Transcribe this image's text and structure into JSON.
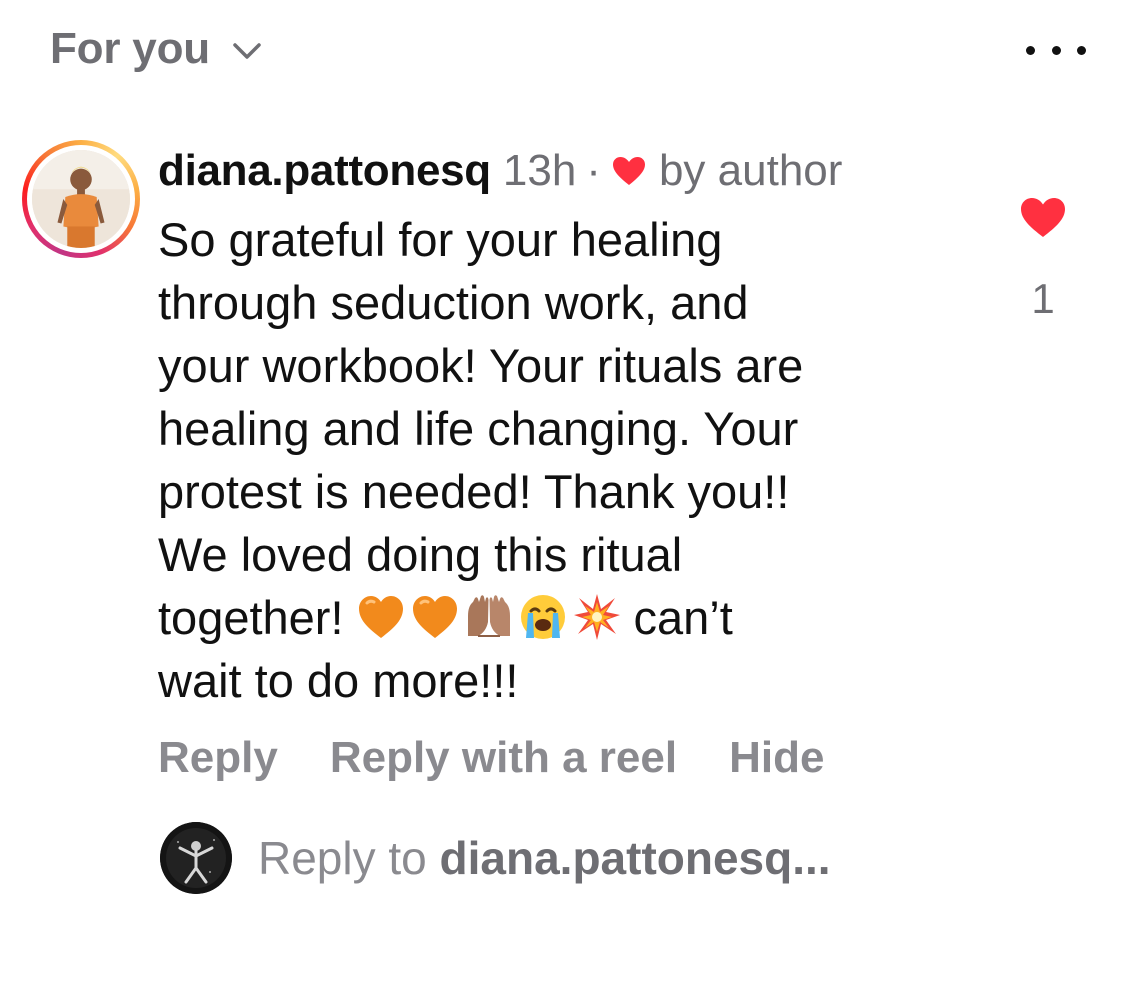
{
  "header": {
    "feed_label": "For you",
    "chevron_icon": "chevron-down-icon",
    "more_icon": "more-horizontal-icon"
  },
  "comment": {
    "username": "diana.pattonesq",
    "time": "13h",
    "separator": "·",
    "liked_by_author_icon": "heart-icon",
    "by_author": "by author",
    "text_lines": [
      "So grateful for your healing",
      "through seduction work, and",
      "your workbook! Your rituals are",
      "healing and life changing. Your",
      "protest is needed! Thank you!!",
      "We loved doing this ritual",
      "together!"
    ],
    "emojis": [
      "orange-heart",
      "orange-heart",
      "raising-hands-medium-skin",
      "loudly-crying-face",
      "collision"
    ],
    "text_after_emoji": "can’t",
    "text_last_line": "wait to do more!!!",
    "actions": {
      "reply": "Reply",
      "reply_with_reel": "Reply with a reel",
      "hide": "Hide"
    },
    "like_count": "1",
    "accent_color": "#ff3040"
  },
  "reply_box": {
    "placeholder_prefix": "Reply to",
    "placeholder_user": "diana.pattonesq..."
  }
}
